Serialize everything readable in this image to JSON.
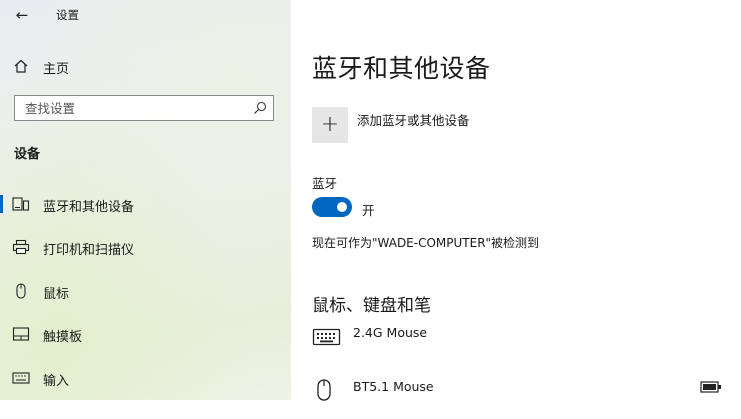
{
  "window": {
    "title": "设置",
    "back_glyph": "←"
  },
  "sidebar": {
    "home_label": "主页",
    "search_placeholder": "查找设置",
    "section_header": "设备",
    "items": [
      {
        "label": "蓝牙和其他设备",
        "icon": "bluetooth-devices-icon",
        "active": true
      },
      {
        "label": "打印机和扫描仪",
        "icon": "printer-icon",
        "active": false
      },
      {
        "label": "鼠标",
        "icon": "mouse-icon",
        "active": false
      },
      {
        "label": "触摸板",
        "icon": "touchpad-icon",
        "active": false
      },
      {
        "label": "输入",
        "icon": "keyboard-icon",
        "active": false
      }
    ]
  },
  "main": {
    "title": "蓝牙和其他设备",
    "add_glyph": "+",
    "add_label": "添加蓝牙或其他设备",
    "bluetooth_label": "蓝牙",
    "bluetooth_state": "开",
    "discoverable_text": "现在可作为\"WADE-COMPUTER\"被检测到",
    "devices_section_title": "鼠标、键盘和笔",
    "devices": [
      {
        "name": "2.4G Mouse",
        "icon": "keyboard-icon"
      },
      {
        "name": "BT5.1 Mouse",
        "icon": "mouse-icon",
        "battery_icon": "battery-icon"
      }
    ]
  },
  "colors": {
    "accent": "#0067c0",
    "add_button_bg": "#e6e6e6"
  }
}
